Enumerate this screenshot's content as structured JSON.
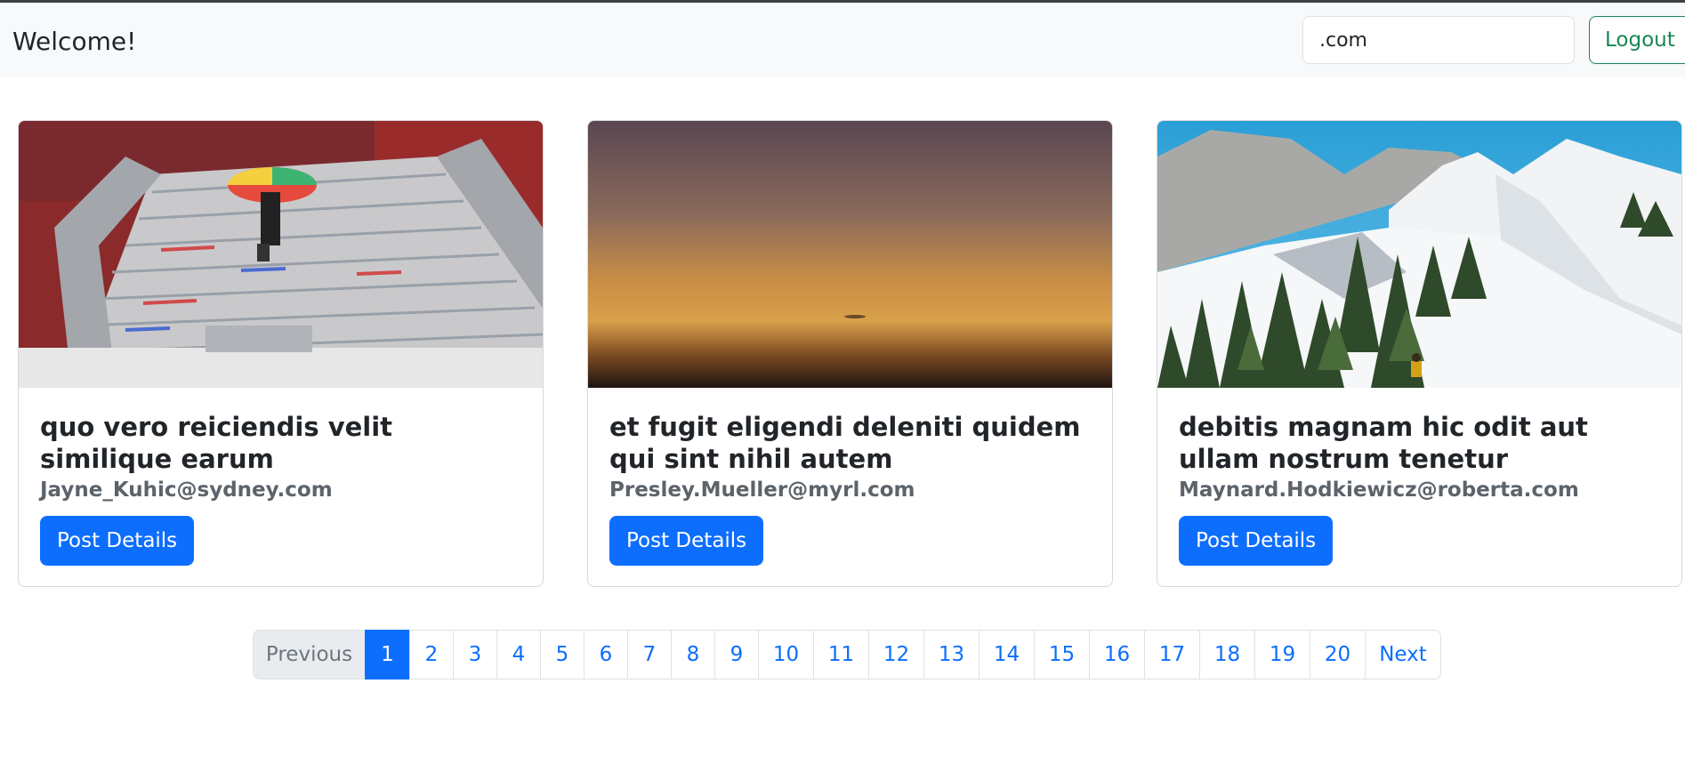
{
  "navbar": {
    "brand": "Welcome!",
    "search_value": ".com",
    "logout_label": "Logout"
  },
  "cards": [
    {
      "title": "quo vero reiciendis velit similique earum",
      "email": "Jayne_Kuhic@sydney.com",
      "button_label": "Post Details"
    },
    {
      "title": "et fugit eligendi deleniti quidem qui sint nihil autem",
      "email": "Presley.Mueller@myrl.com",
      "button_label": "Post Details"
    },
    {
      "title": "debitis magnam hic odit aut ullam nostrum tenetur",
      "email": "Maynard.Hodkiewicz@roberta.com",
      "button_label": "Post Details"
    }
  ],
  "pagination": {
    "previous_label": "Previous",
    "next_label": "Next",
    "pages": [
      "1",
      "2",
      "3",
      "4",
      "5",
      "6",
      "7",
      "8",
      "9",
      "10",
      "11",
      "12",
      "13",
      "14",
      "15",
      "16",
      "17",
      "18",
      "19",
      "20"
    ],
    "active_page": "1"
  },
  "colors": {
    "primary": "#0d6efd",
    "success": "#198754",
    "navbar_bg": "#f8f9fa"
  }
}
